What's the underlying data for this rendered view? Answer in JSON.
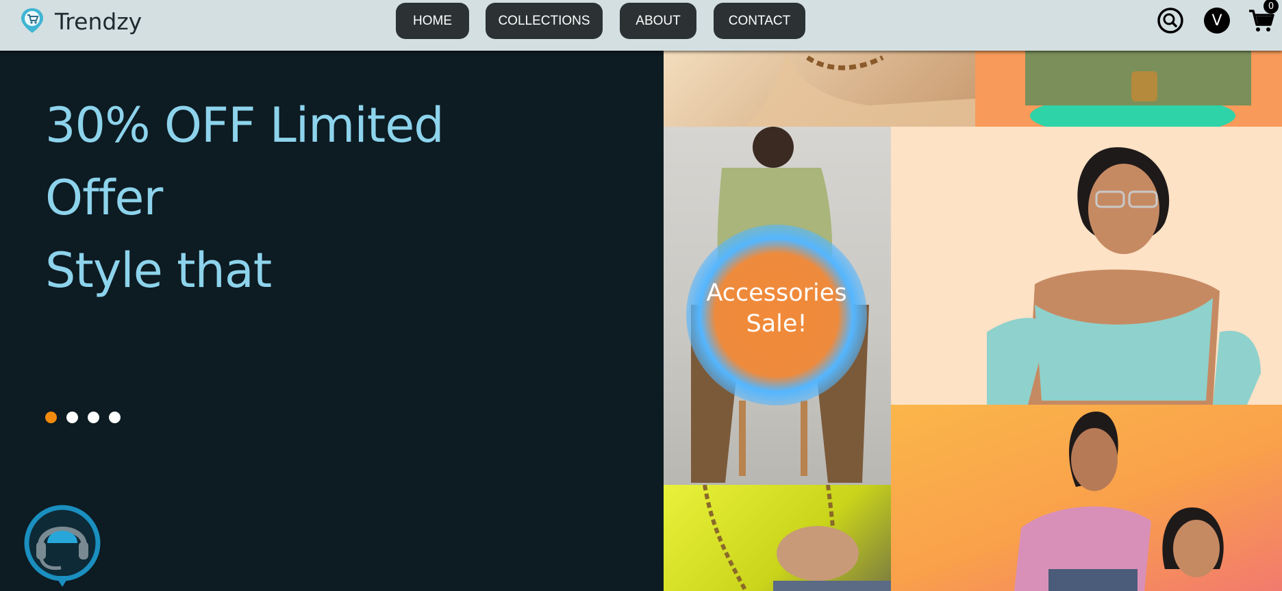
{
  "header": {
    "brand": "Trendzy",
    "nav": [
      {
        "label": "HOME"
      },
      {
        "label": "COLLECTIONS"
      },
      {
        "label": "ABOUT"
      },
      {
        "label": "CONTACT"
      }
    ],
    "search_icon": "search-icon",
    "avatar_initial": "V",
    "cart_icon": "cart-icon",
    "cart_count": "0"
  },
  "hero": {
    "lines": [
      "30% OFF Limited",
      "Offer",
      "Style that"
    ],
    "slides": {
      "count": 4,
      "active_index": 0
    }
  },
  "promo": {
    "sale_line1": "Accessories",
    "sale_line2": "Sale!"
  },
  "support": {
    "icon": "headset-support-icon"
  },
  "colors": {
    "hero_bg": "#0d1b22",
    "hero_text": "#8dd3ec",
    "nav_button": "#2c3234",
    "active_dot": "#f28b0c",
    "sale_glow_ring": "#54b6ff",
    "sale_glow_core": "#f18a3a"
  }
}
